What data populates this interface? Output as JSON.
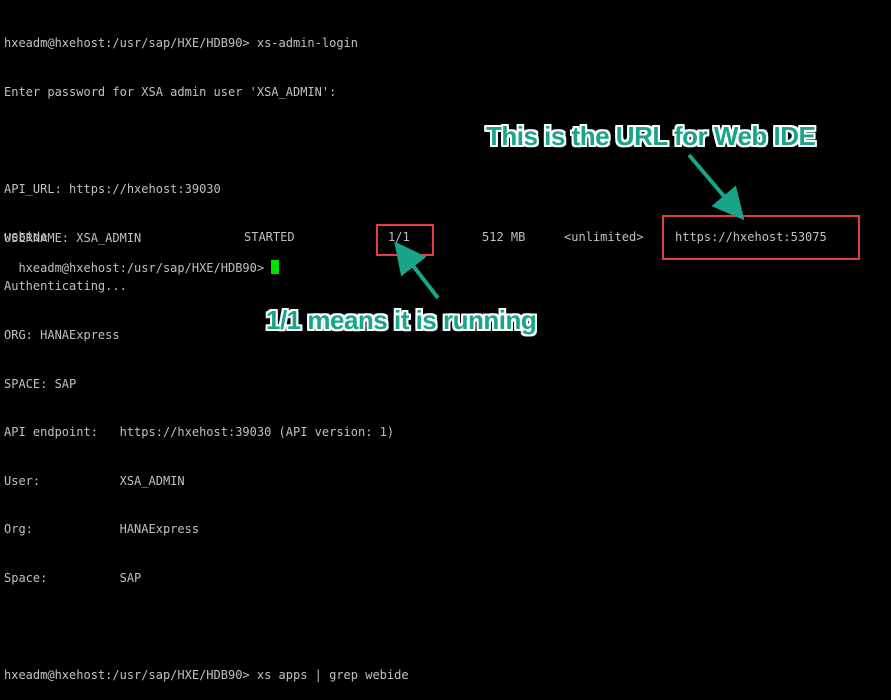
{
  "terminal": {
    "lines": [
      "hxeadm@hxehost:/usr/sap/HXE/HDB90> xs-admin-login",
      "Enter password for XSA admin user 'XSA_ADMIN':",
      "",
      "API_URL: https://hxehost:39030",
      "USERNAME: XSA_ADMIN",
      "Authenticating...",
      "ORG: HANAExpress",
      "SPACE: SAP",
      "API endpoint:   https://hxehost:39030 (API version: 1)",
      "User:           XSA_ADMIN",
      "Org:            HANAExpress",
      "Space:          SAP",
      "",
      "hxeadm@hxehost:/usr/sap/HXE/HDB90> xs apps | grep webide"
    ],
    "apps_row": {
      "name": "webide",
      "state": "STARTED",
      "instances": "1/1",
      "memory": "512 MB",
      "disk": "<unlimited>",
      "url": "https://hxehost:53075"
    },
    "prompt": "hxeadm@hxehost:/usr/sap/HXE/HDB90> "
  },
  "annotations": {
    "url_callout": "This is the URL for Web IDE",
    "running_callout": "1/1 means it is running"
  },
  "colors": {
    "background": "#000000",
    "text": "#c0c0c0",
    "cursor": "#00e000",
    "callout": "#1aa58a",
    "highlight_box": "#e04040"
  }
}
